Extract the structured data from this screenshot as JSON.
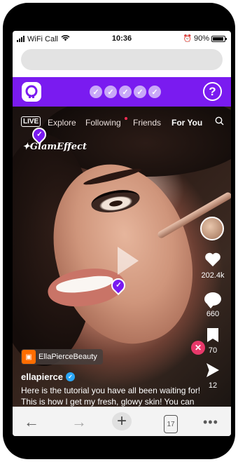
{
  "status_bar": {
    "carrier": "WiFi Call",
    "time": "10:36",
    "battery": "90%"
  },
  "header": {
    "progress_checks": [
      "✓",
      "✓",
      "✓",
      "✓",
      "✓"
    ],
    "help_label": "?",
    "brand_color": "#7a1bf0"
  },
  "video": {
    "top_nav": {
      "live": "LIVE",
      "tabs": [
        "Explore",
        "Following",
        "Friends",
        "For You"
      ],
      "active_tab": "For You"
    },
    "effect_label": "GlamEffect",
    "shop_tag": "EllaPierceBeauty",
    "username": "ellapierce",
    "caption": "Here is the tutorial you have all been waiting for! This is how I get my fresh, glowy skin! You can buy all of the products I used in my ReelLife shop. #makeup #beautiful",
    "likes": "202.4k",
    "comments": "660",
    "saves": "70",
    "shares": "12"
  },
  "browser_bar": {
    "back": "←",
    "forward": "→",
    "new_tab": "+",
    "tab_count": "17",
    "menu": "•••"
  }
}
